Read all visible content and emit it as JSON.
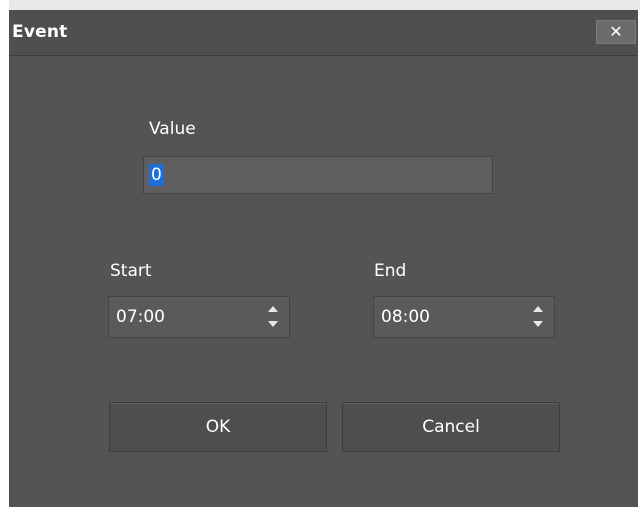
{
  "dialog": {
    "title": "Event",
    "close_label": "✕"
  },
  "value": {
    "label": "Value",
    "input_value": "0"
  },
  "start": {
    "label": "Start",
    "time": "07:00"
  },
  "end": {
    "label": "End",
    "time": "08:00"
  },
  "buttons": {
    "ok": "OK",
    "cancel": "Cancel"
  },
  "colors": {
    "background": "#545454",
    "selection": "#1e6fd8"
  }
}
